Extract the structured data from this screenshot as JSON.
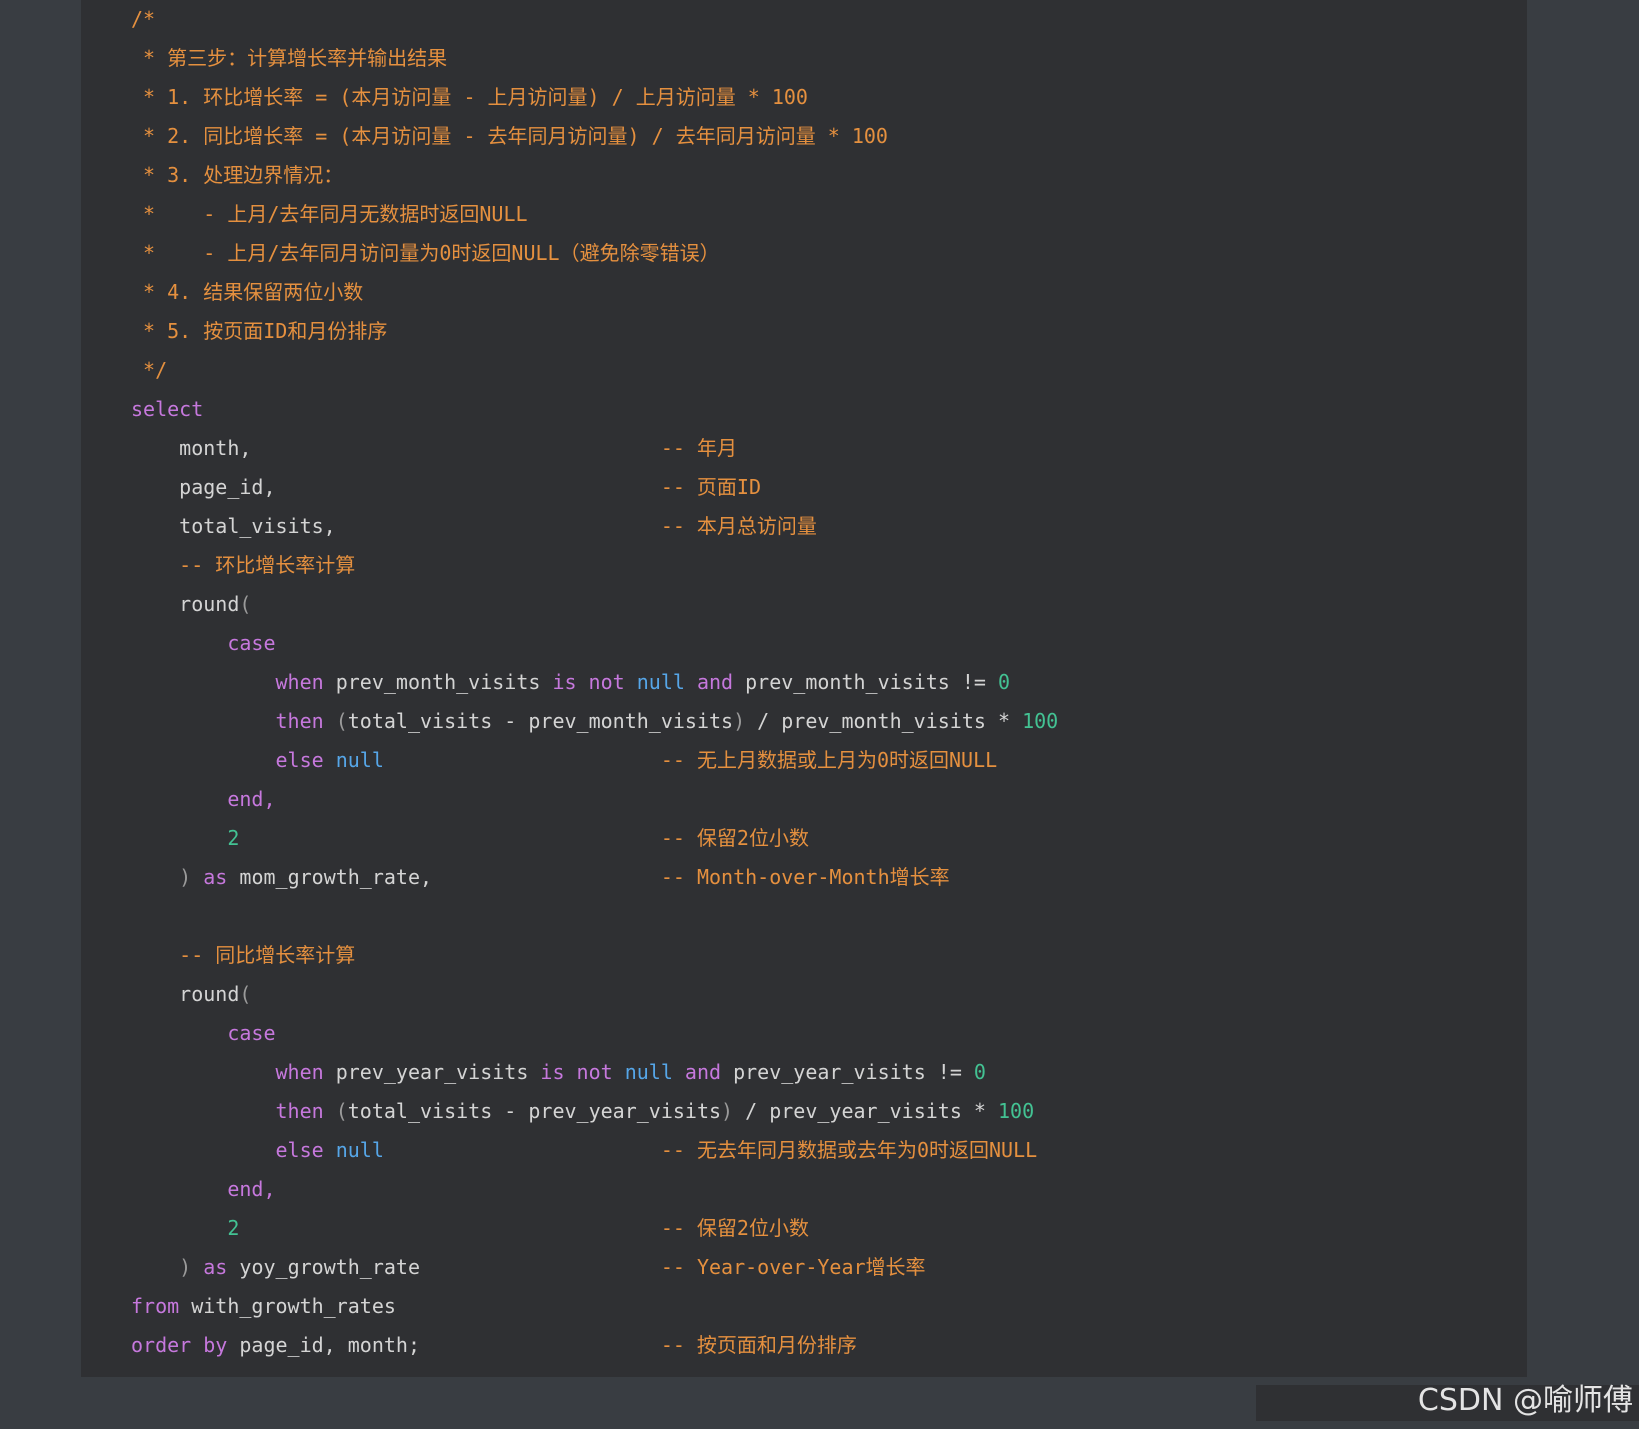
{
  "language_tag": "sql",
  "watermark": "CSDN @喻师傅",
  "colors": {
    "panel_bg": "#2f3033",
    "page_bg": "#393d42",
    "comment": "#e5903f",
    "keyword": "#c678dd",
    "identifier": "#d4d4d4",
    "number": "#43c293",
    "null_literal": "#56a6e8"
  },
  "code": {
    "lines": [
      [
        {
          "t": "/*",
          "c": "cm"
        }
      ],
      [
        {
          "t": " * 第三步：计算增长率并输出结果",
          "c": "cm"
        }
      ],
      [
        {
          "t": " * 1. 环比增长率 = (本月访问量 - 上月访问量) / 上月访问量 * 100",
          "c": "cm"
        }
      ],
      [
        {
          "t": " * 2. 同比增长率 = (本月访问量 - 去年同月访问量) / 去年同月访问量 * 100",
          "c": "cm"
        }
      ],
      [
        {
          "t": " * 3. 处理边界情况：",
          "c": "cm"
        }
      ],
      [
        {
          "t": " *    - 上月/去年同月无数据时返回NULL",
          "c": "cm"
        }
      ],
      [
        {
          "t": " *    - 上月/去年同月访问量为0时返回NULL（避免除零错误）",
          "c": "cm"
        }
      ],
      [
        {
          "t": " * 4. 结果保留两位小数",
          "c": "cm"
        }
      ],
      [
        {
          "t": " * 5. 按页面ID和月份排序",
          "c": "cm"
        }
      ],
      [
        {
          "t": " */",
          "c": "cm"
        }
      ],
      [
        {
          "t": "select",
          "c": "kw"
        }
      ],
      [
        {
          "t": "    month,",
          "c": "id"
        },
        {
          "t": "                                  ",
          "c": "id"
        },
        {
          "t": "-- 年月",
          "c": "cm"
        }
      ],
      [
        {
          "t": "    page_id,",
          "c": "id"
        },
        {
          "t": "                                ",
          "c": "id"
        },
        {
          "t": "-- 页面ID",
          "c": "cm"
        }
      ],
      [
        {
          "t": "    total_visits,",
          "c": "id"
        },
        {
          "t": "                           ",
          "c": "id"
        },
        {
          "t": "-- 本月总访问量",
          "c": "cm"
        }
      ],
      [
        {
          "t": "    -- 环比增长率计算",
          "c": "cm"
        }
      ],
      [
        {
          "t": "    round",
          "c": "id"
        },
        {
          "t": "(",
          "c": "pn"
        }
      ],
      [
        {
          "t": "        case",
          "c": "kw"
        }
      ],
      [
        {
          "t": "            when",
          "c": "kw"
        },
        {
          "t": " prev_month_visits ",
          "c": "id"
        },
        {
          "t": "is not",
          "c": "kw"
        },
        {
          "t": " ",
          "c": "id"
        },
        {
          "t": "null",
          "c": "nul"
        },
        {
          "t": " ",
          "c": "id"
        },
        {
          "t": "and",
          "c": "kw"
        },
        {
          "t": " prev_month_visits != ",
          "c": "id"
        },
        {
          "t": "0",
          "c": "num"
        }
      ],
      [
        {
          "t": "            then",
          "c": "kw"
        },
        {
          "t": " ",
          "c": "id"
        },
        {
          "t": "(",
          "c": "pn"
        },
        {
          "t": "total_visits - prev_month_visits",
          "c": "id"
        },
        {
          "t": ")",
          "c": "pn"
        },
        {
          "t": " / prev_month_visits * ",
          "c": "id"
        },
        {
          "t": "100",
          "c": "num"
        }
      ],
      [
        {
          "t": "            else",
          "c": "kw"
        },
        {
          "t": " ",
          "c": "id"
        },
        {
          "t": "null",
          "c": "nul"
        },
        {
          "t": "                       ",
          "c": "id"
        },
        {
          "t": "-- 无上月数据或上月为0时返回NULL",
          "c": "cm"
        }
      ],
      [
        {
          "t": "        end,",
          "c": "kw"
        }
      ],
      [
        {
          "t": "        ",
          "c": "id"
        },
        {
          "t": "2",
          "c": "num"
        },
        {
          "t": "                                   ",
          "c": "id"
        },
        {
          "t": "-- 保留2位小数",
          "c": "cm"
        }
      ],
      [
        {
          "t": "    ",
          "c": "id"
        },
        {
          "t": ")",
          "c": "pn"
        },
        {
          "t": " ",
          "c": "id"
        },
        {
          "t": "as",
          "c": "kw"
        },
        {
          "t": " mom_growth_rate,",
          "c": "id"
        },
        {
          "t": "                   ",
          "c": "id"
        },
        {
          "t": "-- Month-over-Month增长率",
          "c": "cm"
        }
      ],
      [
        {
          "t": "",
          "c": "id"
        }
      ],
      [
        {
          "t": "    -- 同比增长率计算",
          "c": "cm"
        }
      ],
      [
        {
          "t": "    round",
          "c": "id"
        },
        {
          "t": "(",
          "c": "pn"
        }
      ],
      [
        {
          "t": "        case",
          "c": "kw"
        }
      ],
      [
        {
          "t": "            when",
          "c": "kw"
        },
        {
          "t": " prev_year_visits ",
          "c": "id"
        },
        {
          "t": "is not",
          "c": "kw"
        },
        {
          "t": " ",
          "c": "id"
        },
        {
          "t": "null",
          "c": "nul"
        },
        {
          "t": " ",
          "c": "id"
        },
        {
          "t": "and",
          "c": "kw"
        },
        {
          "t": " prev_year_visits != ",
          "c": "id"
        },
        {
          "t": "0",
          "c": "num"
        }
      ],
      [
        {
          "t": "            then",
          "c": "kw"
        },
        {
          "t": " ",
          "c": "id"
        },
        {
          "t": "(",
          "c": "pn"
        },
        {
          "t": "total_visits - prev_year_visits",
          "c": "id"
        },
        {
          "t": ")",
          "c": "pn"
        },
        {
          "t": " / prev_year_visits * ",
          "c": "id"
        },
        {
          "t": "100",
          "c": "num"
        }
      ],
      [
        {
          "t": "            else",
          "c": "kw"
        },
        {
          "t": " ",
          "c": "id"
        },
        {
          "t": "null",
          "c": "nul"
        },
        {
          "t": "                       ",
          "c": "id"
        },
        {
          "t": "-- 无去年同月数据或去年为0时返回NULL",
          "c": "cm"
        }
      ],
      [
        {
          "t": "        end,",
          "c": "kw"
        }
      ],
      [
        {
          "t": "        ",
          "c": "id"
        },
        {
          "t": "2",
          "c": "num"
        },
        {
          "t": "                                   ",
          "c": "id"
        },
        {
          "t": "-- 保留2位小数",
          "c": "cm"
        }
      ],
      [
        {
          "t": "    ",
          "c": "id"
        },
        {
          "t": ")",
          "c": "pn"
        },
        {
          "t": " ",
          "c": "id"
        },
        {
          "t": "as",
          "c": "kw"
        },
        {
          "t": " yoy_growth_rate",
          "c": "id"
        },
        {
          "t": "                    ",
          "c": "id"
        },
        {
          "t": "-- Year-over-Year增长率",
          "c": "cm"
        }
      ],
      [
        {
          "t": "from",
          "c": "kw"
        },
        {
          "t": " with_growth_rates",
          "c": "id"
        }
      ],
      [
        {
          "t": "order by",
          "c": "kw"
        },
        {
          "t": " page_id, month;",
          "c": "id"
        },
        {
          "t": "                    ",
          "c": "id"
        },
        {
          "t": "-- 按页面和月份排序",
          "c": "cm"
        }
      ]
    ]
  }
}
